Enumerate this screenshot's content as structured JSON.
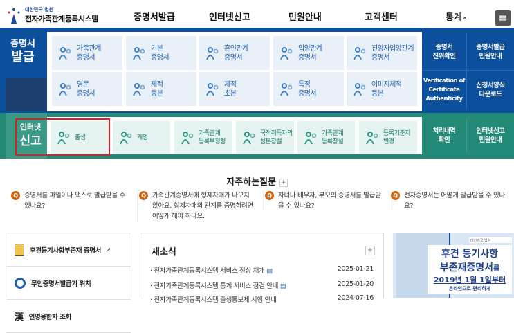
{
  "header": {
    "org": "대한민국 법원",
    "title": "전자가족관계등록시스템",
    "nav": [
      "증명서발급",
      "인터넷신고",
      "민원안내",
      "고객센터",
      "통계"
    ],
    "menu_icon": "hamburger-icon"
  },
  "certificates": {
    "title_line1": "증명서",
    "title_line2": "발급",
    "tiles": [
      [
        "가족관계",
        "증명서"
      ],
      [
        "기본",
        "증명서"
      ],
      [
        "혼인관계",
        "증명서"
      ],
      [
        "입양관계",
        "증명서"
      ],
      [
        "친양자입양관계",
        "증명서"
      ],
      [
        "영문",
        "증명서"
      ],
      [
        "제적",
        "등본"
      ],
      [
        "제적",
        "초본"
      ],
      [
        "특정",
        "증명서"
      ],
      [
        "이미지제적",
        "등본"
      ]
    ],
    "side": [
      [
        "증명서",
        "진위확인"
      ],
      [
        "증명서발급",
        "민원안내"
      ],
      [
        "Verification of",
        "Certificate",
        "Authenticity"
      ],
      [
        "신청서양식",
        "다운로드"
      ]
    ]
  },
  "report": {
    "title_line1": "인터넷",
    "title_line2": "신고",
    "tiles": [
      [
        "출생"
      ],
      [
        "개명"
      ],
      [
        "가족관계",
        "등록부정정"
      ],
      [
        "국적취득자의",
        "성본창설"
      ],
      [
        "가족관계",
        "등록창설"
      ],
      [
        "등록기준지",
        "변경"
      ]
    ],
    "side": [
      [
        "처리내역",
        "확인"
      ],
      [
        "인터넷신고",
        "민원안내"
      ]
    ]
  },
  "faq": {
    "title": "자주하는질문",
    "more": "+",
    "items": [
      "증명서를 파일이나 팩스로 발급받을 수 있나요?",
      "가족관계증명서에 형제자매가 나오지 않아요. 형제자매의 관계를 증명하려면 어떻게 해야 하나요.",
      "자녀나 배우자, 부모의 증명서를 발급받을 수 있나요?",
      "전자증명서는 어떻게 발급받을 수 있나요?"
    ]
  },
  "quick": [
    "후견등기사항부존재 증명서",
    "무인증명서발급기 위치",
    "인명용한자 조회"
  ],
  "news": {
    "title": "새소식",
    "more": "+",
    "items": [
      {
        "title": "전자가족관계등록시스템 서비스 정상 재개",
        "date": "2025-01-21"
      },
      {
        "title": "전자가족관계등록시스템 통계 서비스 점검 안내",
        "date": "2025-01-20"
      },
      {
        "title": "전자가족관계등록시스템 출생통보제 시행 안내",
        "date": "2024-07-16"
      }
    ]
  },
  "banner": {
    "org": "대한민국 법원",
    "line1": "후견 등기사항",
    "line2": "부존재증명서",
    "line2_suffix": "를",
    "line3": "2019년 1월 1일부터",
    "line4": "온라인으로 편리하게"
  }
}
